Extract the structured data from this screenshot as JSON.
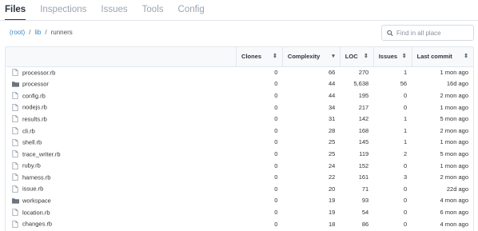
{
  "tabs": [
    {
      "label": "Files",
      "active": true
    },
    {
      "label": "Inspections",
      "active": false
    },
    {
      "label": "Issues",
      "active": false
    },
    {
      "label": "Tools",
      "active": false
    },
    {
      "label": "Config",
      "active": false
    }
  ],
  "breadcrumb": {
    "root": "(root)",
    "sep1": "/",
    "lib": "lib",
    "sep2": "/",
    "current": "runners"
  },
  "search": {
    "placeholder": "Find in all place",
    "value": ""
  },
  "table": {
    "headers": {
      "clones": "Clones",
      "complexity": "Complexity",
      "loc": "LOC",
      "issues": "Issues",
      "last_commit": "Last commit"
    },
    "sort_icons": {
      "clones": "⇕",
      "complexity": "▾",
      "loc": "⇕",
      "issues": "⇕",
      "last_commit": "⇕"
    },
    "rows": [
      {
        "type": "file",
        "name": "processor.rb",
        "clones": "0",
        "complexity": "66",
        "loc": "270",
        "issues": "1",
        "last_commit": "1 mon ago"
      },
      {
        "type": "folder",
        "name": "processor",
        "clones": "0",
        "complexity": "44",
        "loc": "5,638",
        "issues": "56",
        "last_commit": "16d ago"
      },
      {
        "type": "file",
        "name": "config.rb",
        "clones": "0",
        "complexity": "44",
        "loc": "195",
        "issues": "0",
        "last_commit": "2 mon ago"
      },
      {
        "type": "file",
        "name": "nodejs.rb",
        "clones": "0",
        "complexity": "34",
        "loc": "217",
        "issues": "0",
        "last_commit": "1 mon ago"
      },
      {
        "type": "file",
        "name": "results.rb",
        "clones": "0",
        "complexity": "31",
        "loc": "142",
        "issues": "1",
        "last_commit": "5 mon ago"
      },
      {
        "type": "file",
        "name": "cli.rb",
        "clones": "0",
        "complexity": "28",
        "loc": "168",
        "issues": "1",
        "last_commit": "2 mon ago"
      },
      {
        "type": "file",
        "name": "shell.rb",
        "clones": "0",
        "complexity": "25",
        "loc": "145",
        "issues": "1",
        "last_commit": "1 mon ago"
      },
      {
        "type": "file",
        "name": "trace_writer.rb",
        "clones": "0",
        "complexity": "25",
        "loc": "119",
        "issues": "2",
        "last_commit": "5 mon ago"
      },
      {
        "type": "file",
        "name": "ruby.rb",
        "clones": "0",
        "complexity": "24",
        "loc": "152",
        "issues": "0",
        "last_commit": "1 mon ago"
      },
      {
        "type": "file",
        "name": "harness.rb",
        "clones": "0",
        "complexity": "22",
        "loc": "161",
        "issues": "3",
        "last_commit": "2 mon ago"
      },
      {
        "type": "file",
        "name": "issue.rb",
        "clones": "0",
        "complexity": "20",
        "loc": "71",
        "issues": "0",
        "last_commit": "22d ago"
      },
      {
        "type": "folder",
        "name": "workspace",
        "clones": "0",
        "complexity": "19",
        "loc": "93",
        "issues": "0",
        "last_commit": "4 mon ago"
      },
      {
        "type": "file",
        "name": "location.rb",
        "clones": "0",
        "complexity": "19",
        "loc": "54",
        "issues": "0",
        "last_commit": "6 mon ago"
      },
      {
        "type": "file",
        "name": "changes.rb",
        "clones": "0",
        "complexity": "18",
        "loc": "86",
        "issues": "0",
        "last_commit": "4 mon ago"
      }
    ]
  },
  "colors": {
    "link": "#3a86c8",
    "tab_active": "#2b3440",
    "tab_inactive": "#9aa4b2",
    "folder_icon": "#6b7480"
  }
}
